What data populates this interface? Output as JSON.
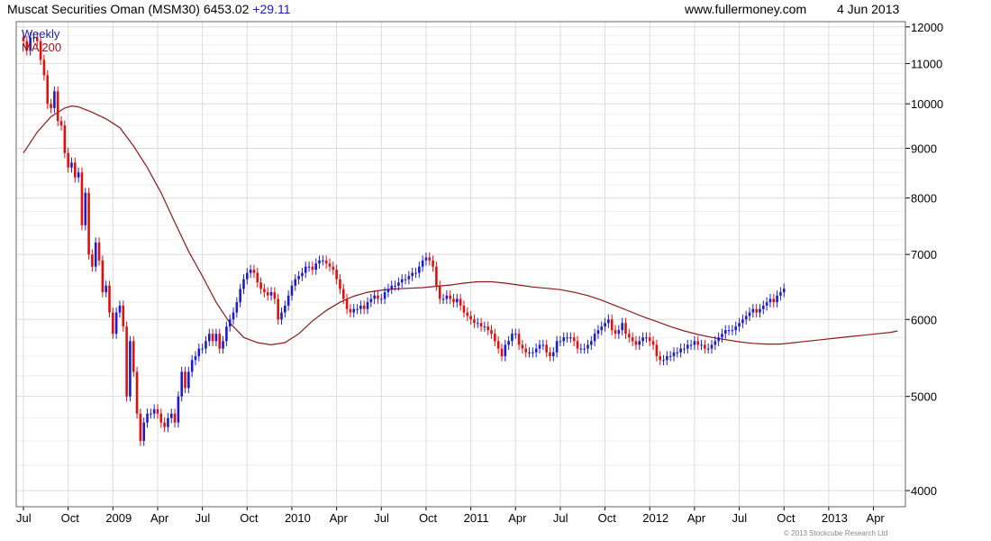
{
  "header": {
    "title": "Muscat Securities Oman (MSM30)",
    "last": "6453.02",
    "change": "+29.11",
    "source": "www.fullermoney.com",
    "date": "4 Jun 2013"
  },
  "footer": {
    "copyright": "© 2013 Stockcube Research Ltd"
  },
  "colors": {
    "up": "#1c1ccc",
    "down": "#e01010",
    "ma": "#8b1a1a",
    "grid": "#dcdcdc"
  },
  "chart_data": {
    "type": "candlestick",
    "title": "Muscat Securities Oman (MSM30) 6453.02 +29.11",
    "ylim": [
      3850,
      12150
    ],
    "y_scale": "log",
    "y_ticks": [
      4000,
      5000,
      6000,
      7000,
      8000,
      9000,
      10000,
      11000,
      12000
    ],
    "x_ticks": [
      "Jul",
      "Oct",
      "2009",
      "Apr",
      "Jul",
      "Oct",
      "2010",
      "Apr",
      "Jul",
      "Oct",
      "2011",
      "Apr",
      "Jul",
      "Oct",
      "2012",
      "Apr",
      "Jul",
      "Oct",
      "2013",
      "Apr"
    ],
    "x_tick_weeks": [
      0,
      13,
      26,
      39,
      52,
      65,
      78,
      91,
      104,
      117,
      130,
      143,
      156,
      169,
      182,
      195,
      208,
      221,
      234,
      247
    ],
    "grid": true,
    "legend": {
      "position": "top-left",
      "entries": [
        {
          "name": "Weekly",
          "color": "#1a1ab4"
        },
        {
          "name": "MA 200",
          "color": "#8b1a1a"
        }
      ]
    },
    "closes": [
      11600,
      11350,
      11700,
      11700,
      11600,
      11100,
      10700,
      10000,
      9900,
      10300,
      9600,
      9500,
      8900,
      8600,
      8700,
      8400,
      8500,
      7500,
      8100,
      7000,
      6800,
      7200,
      6900,
      6400,
      6500,
      6100,
      5800,
      6100,
      6200,
      5900,
      5000,
      5700,
      5300,
      4800,
      4500,
      4700,
      4800,
      4800,
      4850,
      4800,
      4700,
      4650,
      4750,
      4800,
      4700,
      5000,
      5300,
      5100,
      5300,
      5450,
      5500,
      5600,
      5600,
      5700,
      5800,
      5700,
      5800,
      5600,
      5700,
      5900,
      6000,
      6100,
      6250,
      6450,
      6600,
      6700,
      6750,
      6700,
      6550,
      6450,
      6400,
      6350,
      6400,
      6300,
      6000,
      6100,
      6200,
      6350,
      6500,
      6600,
      6650,
      6700,
      6800,
      6800,
      6750,
      6850,
      6900,
      6900,
      6850,
      6800,
      6750,
      6600,
      6450,
      6300,
      6150,
      6100,
      6150,
      6150,
      6200,
      6150,
      6250,
      6300,
      6350,
      6300,
      6300,
      6400,
      6450,
      6500,
      6500,
      6550,
      6600,
      6600,
      6650,
      6700,
      6700,
      6800,
      6900,
      6950,
      6900,
      6800,
      6500,
      6300,
      6300,
      6350,
      6300,
      6250,
      6300,
      6200,
      6100,
      6050,
      6000,
      5950,
      5950,
      5900,
      5900,
      5850,
      5800,
      5700,
      5600,
      5500,
      5650,
      5700,
      5800,
      5800,
      5650,
      5600,
      5550,
      5550,
      5550,
      5600,
      5650,
      5650,
      5550,
      5500,
      5550,
      5700,
      5700,
      5750,
      5750,
      5750,
      5700,
      5600,
      5600,
      5600,
      5650,
      5700,
      5800,
      5850,
      5900,
      5950,
      6000,
      5850,
      5800,
      5850,
      5950,
      5800,
      5750,
      5700,
      5650,
      5700,
      5750,
      5750,
      5700,
      5650,
      5500,
      5450,
      5450,
      5500,
      5500,
      5550,
      5550,
      5600,
      5600,
      5650,
      5650,
      5700,
      5650,
      5650,
      5600,
      5600,
      5650,
      5700,
      5750,
      5800,
      5850,
      5850,
      5850,
      5900,
      5950,
      6000,
      6050,
      6100,
      6150,
      6100,
      6150,
      6200,
      6250,
      6300,
      6250,
      6350,
      6400,
      6453.02
    ],
    "ma200": [
      {
        "week": 0,
        "value": 8900
      },
      {
        "week": 4,
        "value": 9350
      },
      {
        "week": 8,
        "value": 9700
      },
      {
        "week": 12,
        "value": 9900
      },
      {
        "week": 14,
        "value": 9950
      },
      {
        "week": 16,
        "value": 9930
      },
      {
        "week": 20,
        "value": 9800
      },
      {
        "week": 24,
        "value": 9650
      },
      {
        "week": 28,
        "value": 9450
      },
      {
        "week": 32,
        "value": 9050
      },
      {
        "week": 36,
        "value": 8600
      },
      {
        "week": 40,
        "value": 8100
      },
      {
        "week": 44,
        "value": 7550
      },
      {
        "week": 48,
        "value": 7050
      },
      {
        "week": 52,
        "value": 6650
      },
      {
        "week": 56,
        "value": 6250
      },
      {
        "week": 60,
        "value": 5950
      },
      {
        "week": 64,
        "value": 5750
      },
      {
        "week": 68,
        "value": 5680
      },
      {
        "week": 72,
        "value": 5650
      },
      {
        "week": 76,
        "value": 5680
      },
      {
        "week": 80,
        "value": 5800
      },
      {
        "week": 84,
        "value": 5980
      },
      {
        "week": 88,
        "value": 6130
      },
      {
        "week": 92,
        "value": 6250
      },
      {
        "week": 96,
        "value": 6340
      },
      {
        "week": 100,
        "value": 6400
      },
      {
        "week": 104,
        "value": 6430
      },
      {
        "week": 108,
        "value": 6450
      },
      {
        "week": 112,
        "value": 6460
      },
      {
        "week": 116,
        "value": 6470
      },
      {
        "week": 120,
        "value": 6490
      },
      {
        "week": 124,
        "value": 6510
      },
      {
        "week": 128,
        "value": 6540
      },
      {
        "week": 132,
        "value": 6560
      },
      {
        "week": 136,
        "value": 6560
      },
      {
        "week": 140,
        "value": 6540
      },
      {
        "week": 144,
        "value": 6510
      },
      {
        "week": 148,
        "value": 6480
      },
      {
        "week": 152,
        "value": 6460
      },
      {
        "week": 156,
        "value": 6440
      },
      {
        "week": 160,
        "value": 6400
      },
      {
        "week": 164,
        "value": 6350
      },
      {
        "week": 168,
        "value": 6280
      },
      {
        "week": 172,
        "value": 6200
      },
      {
        "week": 176,
        "value": 6120
      },
      {
        "week": 180,
        "value": 6040
      },
      {
        "week": 184,
        "value": 5970
      },
      {
        "week": 188,
        "value": 5900
      },
      {
        "week": 192,
        "value": 5840
      },
      {
        "week": 196,
        "value": 5790
      },
      {
        "week": 200,
        "value": 5750
      },
      {
        "week": 204,
        "value": 5720
      },
      {
        "week": 208,
        "value": 5690
      },
      {
        "week": 212,
        "value": 5670
      },
      {
        "week": 216,
        "value": 5660
      },
      {
        "week": 220,
        "value": 5660
      },
      {
        "week": 224,
        "value": 5680
      },
      {
        "week": 228,
        "value": 5700
      },
      {
        "week": 232,
        "value": 5720
      },
      {
        "week": 236,
        "value": 5740
      },
      {
        "week": 240,
        "value": 5760
      },
      {
        "week": 244,
        "value": 5780
      },
      {
        "week": 248,
        "value": 5800
      },
      {
        "week": 252,
        "value": 5820
      },
      {
        "week": 254,
        "value": 5840
      }
    ]
  }
}
